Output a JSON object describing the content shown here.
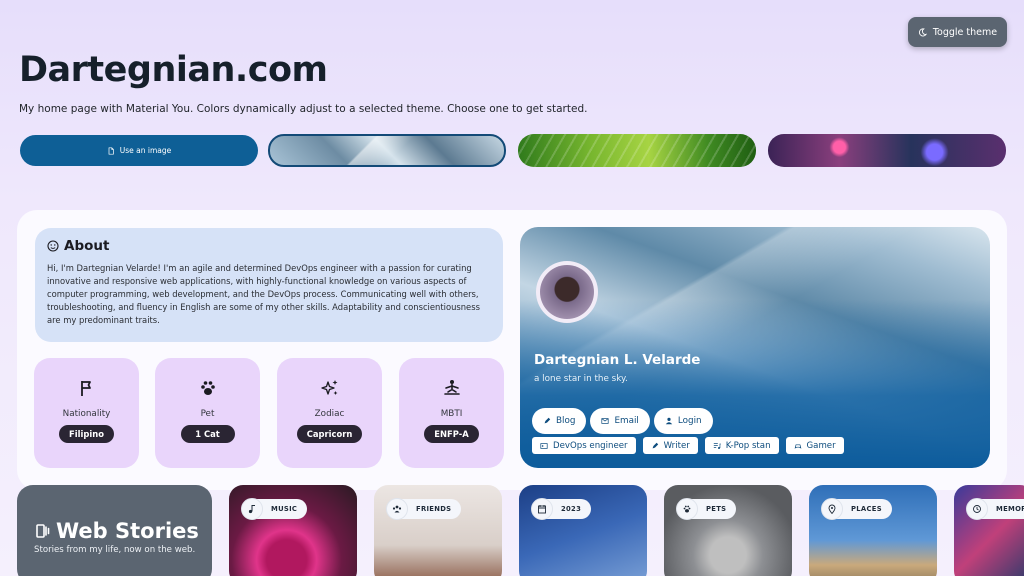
{
  "header": {
    "toggle_label": "Toggle theme",
    "toggle_icon": "moon-icon",
    "title": "Dartegnian.com",
    "tagline": "My home page with Material You. Colors dynamically adjust to a selected theme. Choose one to get started."
  },
  "themes": {
    "use_image_label": "Use an image",
    "use_image_icon": "file-icon",
    "options": [
      "glass-cubes-theme",
      "leaf-theme",
      "arcade-theme"
    ],
    "selected": "glass-cubes-theme"
  },
  "about": {
    "heading": "About",
    "icon": "face-icon",
    "text": "Hi, I'm Dartegnian Velarde! I'm an agile and determined DevOps engineer with a passion for curating innovative and responsive web applications, with highly-functional knowledge on various aspects of computer programming, web development, and the DevOps process. Communicating well with others, troubleshooting, and fluency in English are some of my other skills. Adaptability and conscientiousness are my predominant traits."
  },
  "facts": [
    {
      "label": "Nationality",
      "value": "Filipino",
      "icon": "flag-icon"
    },
    {
      "label": "Pet",
      "value": "1 Cat",
      "icon": "paw-icon"
    },
    {
      "label": "Zodiac",
      "value": "Capricorn",
      "icon": "sparkles-icon"
    },
    {
      "label": "MBTI",
      "value": "ENFP-A",
      "icon": "meditation-icon"
    }
  ],
  "profile": {
    "name": "Dartegnian L. Velarde",
    "motto": "a lone star in the sky.",
    "links": [
      {
        "label": "Blog",
        "icon": "pencil-icon"
      },
      {
        "label": "Email",
        "icon": "mail-icon"
      },
      {
        "label": "Login",
        "icon": "user-icon"
      }
    ],
    "roles": [
      {
        "label": "DevOps engineer",
        "icon": "terminal-icon"
      },
      {
        "label": "Writer",
        "icon": "pencil-icon"
      },
      {
        "label": "K-Pop stan",
        "icon": "playlist-icon"
      },
      {
        "label": "Gamer",
        "icon": "gamepad-icon"
      }
    ]
  },
  "stories": {
    "title": "Web Stories",
    "subtitle": "Stories from my life, now on the web.",
    "icon": "stories-icon",
    "items": [
      {
        "tag": "MUSIC",
        "icon": "music-icon"
      },
      {
        "tag": "FRIENDS",
        "icon": "group-icon"
      },
      {
        "tag": "2023",
        "icon": "calendar-icon"
      },
      {
        "tag": "PETS",
        "icon": "paw-icon"
      },
      {
        "tag": "PLACES",
        "icon": "pin-icon"
      },
      {
        "tag": "MEMOR",
        "icon": "memory-icon"
      }
    ]
  }
}
